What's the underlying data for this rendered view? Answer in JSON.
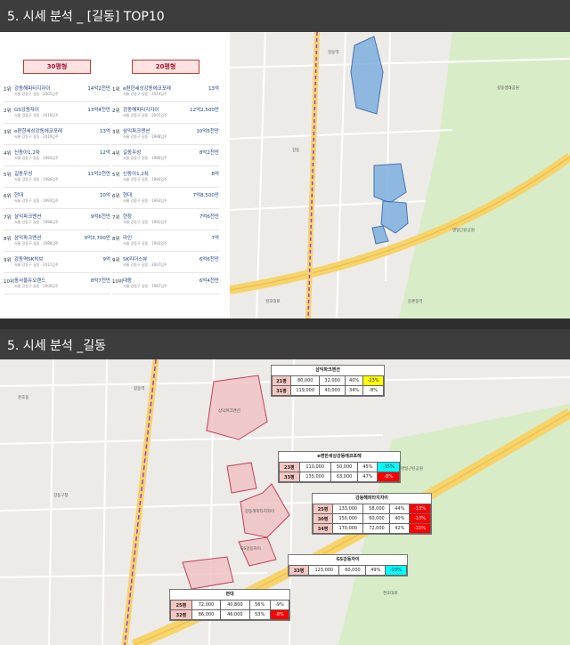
{
  "slides": {
    "top_title": "5. 시세 분석 _ [길동] TOP10",
    "bottom_title": "5. 시세 분석 _길동"
  },
  "ranking": {
    "left_header": "30평형",
    "right_header": "20평형",
    "left": [
      {
        "rank": "1위",
        "name": "강동해피타지자이",
        "sub": "서울 강동구 길동 · 2005입주",
        "price": "14억2천만"
      },
      {
        "rank": "2위",
        "name": "GS강동자이",
        "sub": "서울 강동구 길동 · 2010입주",
        "price": "13억4천만"
      },
      {
        "rank": "3위",
        "name": "e편한세상강동에코포레",
        "sub": "서울 강동구 길동 · 2019입주",
        "price": "13억"
      },
      {
        "rank": "4위",
        "name": "신동아1,2차",
        "sub": "서울 강동구 길동 · 1984입주",
        "price": "12억"
      },
      {
        "rank": "5위",
        "name": "길동우성",
        "sub": "서울 강동구 길동 · 1986입주",
        "price": "11억2천만"
      },
      {
        "rank": "6위",
        "name": "현대",
        "sub": "서울 강동구 길동 · 1993입주",
        "price": "10억"
      },
      {
        "rank": "7위",
        "name": "삼익파크맨션",
        "sub": "서울 강동구 길동 · 1988입주",
        "price": "9억6천만"
      },
      {
        "rank": "8위",
        "name": "삼익파크맨션",
        "sub": "서울 강동구 길동 · 1988입주",
        "price": "9억3,700만"
      },
      {
        "rank": "9위",
        "name": "강동역SK허브",
        "sub": "서울 강동구 길동 · 2011입주",
        "price": "9억"
      },
      {
        "rank": "10위",
        "name": "동서울유오랜드",
        "sub": "서울 강동구 길동 · 2000입주",
        "price": "8억7천만"
      }
    ],
    "right": [
      {
        "rank": "1위",
        "name": "e편한세상강동에코포레",
        "sub": "서울 강동구 길동 · 2019입주",
        "price": "13억"
      },
      {
        "rank": "2위",
        "name": "강동해피타지자이",
        "sub": "서울 강동구 길동 · 2005입주",
        "price": "12억2,500만"
      },
      {
        "rank": "3위",
        "name": "삼익파크맨션",
        "sub": "서울 강동구 길동 · 1988입주",
        "price": "10억5천만"
      },
      {
        "rank": "4위",
        "name": "길동우성",
        "sub": "서울 강동구 길동 · 1986입주",
        "price": "8억2천만"
      },
      {
        "rank": "5위",
        "name": "신동아1,2차",
        "sub": "서울 강동구 길동 · 1984입주",
        "price": "8억"
      },
      {
        "rank": "6위",
        "name": "현대",
        "sub": "서울 강동구 길동 · 1993입주",
        "price": "7억8,500만"
      },
      {
        "rank": "7위",
        "name": "현창",
        "sub": "서울 강동구 길동 · 1991입주",
        "price": "7억6천만"
      },
      {
        "rank": "8위",
        "name": "라인",
        "sub": "서울 강동구 길동 · 1992입주",
        "price": "7억"
      },
      {
        "rank": "9위",
        "name": "SK리더스뷰",
        "sub": "서울 강동구 길동 · 2007입주",
        "price": "6억6천만"
      },
      {
        "rank": "10위",
        "name": "대동",
        "sub": "서울 강동구 길동 · 1987입주",
        "price": "6억4천만"
      }
    ]
  },
  "price_boxes": [
    {
      "title": "삼익파크맨션",
      "rows": [
        {
          "pyeong": "21평",
          "sale": "80,000",
          "jeonse": "32,000",
          "ratio": "40%",
          "change": "-23%",
          "style": "yellow"
        },
        {
          "pyeong": "31평",
          "sale": "119,000",
          "jeonse": "40,000",
          "ratio": "34%",
          "change": "-8%",
          "style": "plain"
        }
      ]
    },
    {
      "title": "e편한세상강동에코포레",
      "rows": [
        {
          "pyeong": "23평",
          "sale": "110,000",
          "jeonse": "50,000",
          "ratio": "45%",
          "change": "-15%",
          "style": "cyan"
        },
        {
          "pyeong": "33평",
          "sale": "135,000",
          "jeonse": "63,000",
          "ratio": "47%",
          "change": "-8%",
          "style": "red"
        }
      ]
    },
    {
      "title": "강동해피타지자이",
      "rows": [
        {
          "pyeong": "25평",
          "sale": "133,000",
          "jeonse": "58,000",
          "ratio": "44%",
          "change": "-13%",
          "style": "red"
        },
        {
          "pyeong": "30평",
          "sale": "150,000",
          "jeonse": "60,000",
          "ratio": "40%",
          "change": "-13%",
          "style": "red"
        },
        {
          "pyeong": "34평",
          "sale": "170,000",
          "jeonse": "72,000",
          "ratio": "42%",
          "change": "-15%",
          "style": "red"
        }
      ]
    },
    {
      "title": "GS강동자이",
      "rows": [
        {
          "pyeong": "33평",
          "sale": "123,000",
          "jeonse": "60,000",
          "ratio": "49%",
          "change": "-19%",
          "style": "cyan"
        }
      ]
    },
    {
      "title": "현대",
      "rows": [
        {
          "pyeong": "25평",
          "sale": "72,000",
          "jeonse": "40,800",
          "ratio": "56%",
          "change": "-9%",
          "style": "plain"
        },
        {
          "pyeong": "32평",
          "sale": "86,000",
          "jeonse": "46,000",
          "ratio": "53%",
          "change": "-8%",
          "style": "red"
        }
      ]
    }
  ],
  "map_labels": {
    "top": [
      "길동",
      "강동역",
      "명일근린공원",
      "길동생태공원",
      "천호대로",
      "둔촌동역"
    ],
    "bottom": [
      "천호동",
      "길동역",
      "강동구청",
      "삼익파크맨션",
      "강동해피타지자이",
      "GS강동자이",
      "천호대로",
      "명일근린공원"
    ]
  },
  "colors": {
    "accent_pink": "#fde2e2",
    "accent_red": "#c0392b",
    "polygon_blue": "#7fb0e0",
    "polygon_pink": "#f0c4c4"
  }
}
